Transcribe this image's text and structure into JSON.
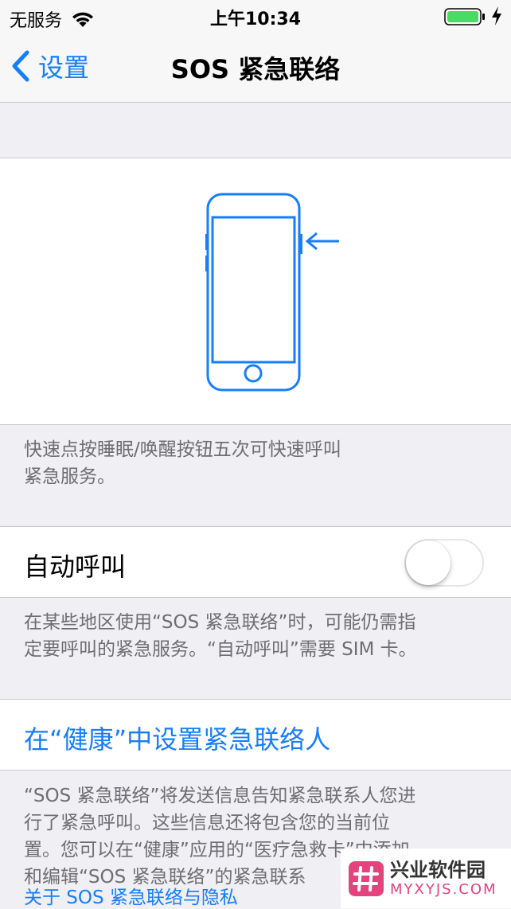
{
  "status_bar": {
    "carrier": "无服务",
    "time": "上午10:34",
    "icons": [
      "wifi-icon",
      "battery-icon",
      "charging-icon"
    ]
  },
  "nav": {
    "back_label": "设置",
    "title": "SOS 紧急联络",
    "icons": [
      "chevron-left-icon"
    ]
  },
  "illustration": {
    "icon": "phone-side-button-icon",
    "accent_color": "#157efb"
  },
  "sections": {
    "illustration_footer_line1": "快速点按睡眠/唤醒按钮五次可快速呼叫",
    "illustration_footer_line2": "紧急服务。",
    "auto_call_label": "自动呼叫",
    "auto_call_toggle_on": false,
    "auto_call_footer_line1": "在某些地区使用“SOS 紧急联络”时，可能仍需指",
    "auto_call_footer_line2": "定要呼叫的紧急服务。“自动呼叫”需要 SIM 卡。",
    "health_link_label": "在“健康”中设置紧急联络人",
    "health_footer_line1": "“SOS 紧急联络”将发送信息告知紧急联系人您进",
    "health_footer_line2": "行了紧急呼叫。这些信息还将包含您的当前位",
    "health_footer_line3": "置。您可以在“健康”应用的“医疗急救卡”中添加",
    "health_footer_line4": "和编辑“SOS 紧急联络”的紧急联系",
    "privacy_link": "关于 SOS 紧急联络与隐私"
  },
  "watermark": {
    "name": "兴业软件园",
    "url": "MYXYJS.COM"
  },
  "colors": {
    "accent": "#157efb",
    "background": "#efeff4",
    "footer_text": "#6d6d72",
    "battery": "#4cd964"
  }
}
